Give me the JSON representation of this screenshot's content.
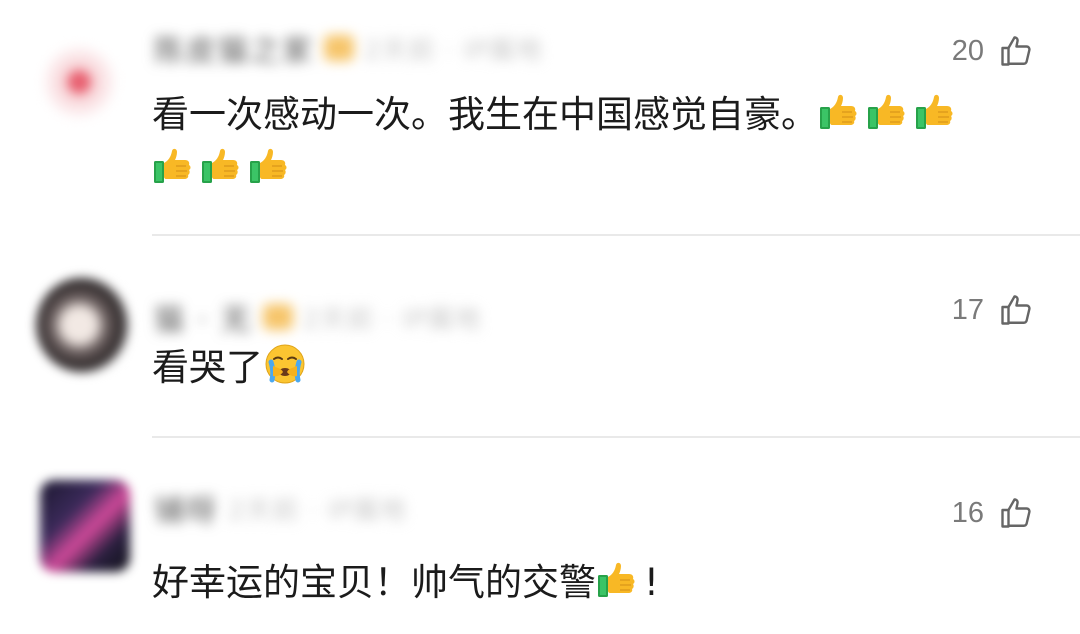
{
  "comments": [
    {
      "username": "陈皮猫之家",
      "meta": "2天前 · IP属地",
      "likes": "20",
      "text_main": "看一次感动一次。我生在中国感觉自豪。",
      "emoji_name": "thumbs-up-icon"
    },
    {
      "username": "猫 · 无",
      "meta": "2天前 · IP属地",
      "likes": "17",
      "text_main": "看哭了",
      "emoji_name": "crying-face-icon"
    },
    {
      "username": "铺呀",
      "meta": "2天前 · IP属地",
      "likes": "16",
      "text_main": "好幸运的宝贝！帅气的交警",
      "text_after": "!",
      "emoji_name": "thumbs-up-icon"
    }
  ],
  "colors": {
    "background": "#ffffff",
    "text": "#1b1b1b",
    "like_gray": "#7a7a7a",
    "divider": "#e9e9e9"
  }
}
